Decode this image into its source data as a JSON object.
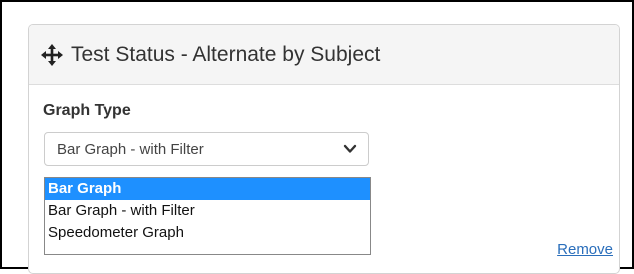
{
  "widget": {
    "title": "Test Status - Alternate by Subject",
    "move_icon": "move-arrows-icon"
  },
  "graph_type": {
    "label": "Graph Type",
    "selected_value": "Bar Graph - with Filter",
    "options": [
      {
        "label": "Bar Graph",
        "highlighted": true
      },
      {
        "label": "Bar Graph - with Filter",
        "highlighted": false
      },
      {
        "label": "Speedometer Graph",
        "highlighted": false
      }
    ]
  },
  "actions": {
    "remove_label": "Remove"
  },
  "colors": {
    "highlight": "#1e90ff",
    "link": "#2a6ebb",
    "header_bg": "#f5f5f5"
  }
}
